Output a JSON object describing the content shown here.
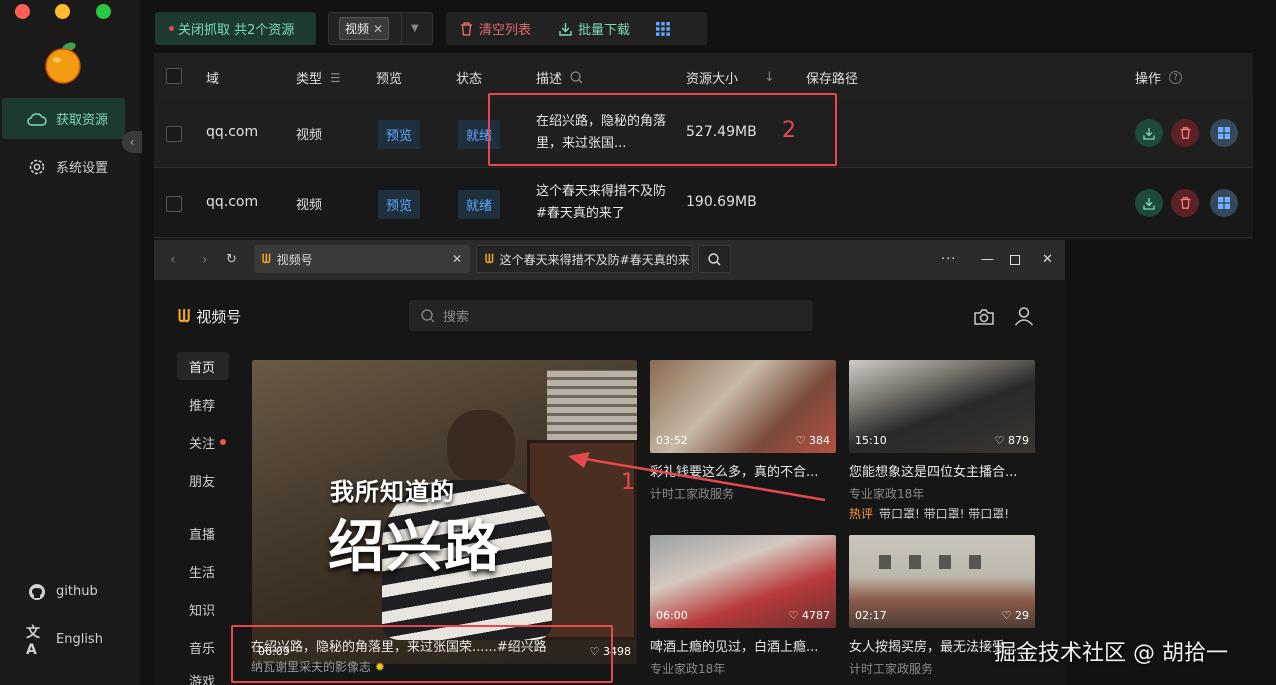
{
  "sidebar": {
    "items": [
      {
        "label": "获取资源",
        "icon": "cloud-icon"
      },
      {
        "label": "系统设置",
        "icon": "gear-icon"
      },
      {
        "label": "github",
        "icon": "github-icon"
      },
      {
        "label": "English",
        "icon": "translate-icon"
      }
    ]
  },
  "toolbar": {
    "capture_label": "关闭抓取 共2个资源",
    "filter_tag": "视频",
    "clear_label": "清空列表",
    "batch_download_label": "批量下载"
  },
  "table": {
    "headers": {
      "domain": "域",
      "type": "类型",
      "preview": "预览",
      "status": "状态",
      "desc": "描述",
      "size": "资源大小",
      "path": "保存路径",
      "ops": "操作"
    },
    "rows": [
      {
        "domain": "qq.com",
        "type": "视频",
        "preview": "预览",
        "status": "就绪",
        "desc": "在绍兴路，隐秘的角落里，来过张国...",
        "size": "527.49MB"
      },
      {
        "domain": "qq.com",
        "type": "视频",
        "preview": "预览",
        "status": "就绪",
        "desc": "这个春天来得措不及防#春天真的来了",
        "size": "190.69MB"
      }
    ]
  },
  "browser": {
    "tabs": [
      {
        "label": "视频号"
      },
      {
        "label": "这个春天来得措不及防#春天真的来"
      }
    ],
    "brand": "视频号",
    "search_placeholder": "搜索",
    "nav": [
      "首页",
      "推荐",
      "关注",
      "朋友",
      "直播",
      "生活",
      "知识",
      "音乐",
      "游戏"
    ],
    "featured": {
      "overlay_line1": "我所知道的",
      "overlay_line2": "绍兴路",
      "duration": "06:09",
      "likes": "3498",
      "title": "在绍兴路，隐秘的角落里，来过张国荣......#绍兴路",
      "author": "纳瓦谢里采夫的影像志"
    },
    "cards": [
      {
        "duration": "03:52",
        "likes": "384",
        "title": "彩礼钱要这么多，真的不合...",
        "author": "计时工家政服务",
        "hot_label": "",
        "hot_text": ""
      },
      {
        "duration": "15:10",
        "likes": "879",
        "title": "您能想象这是四位女主播合...",
        "author": "专业家政18年",
        "hot_label": "热评",
        "hot_text": "带口罩! 带口罩! 带口罩!"
      },
      {
        "duration": "06:00",
        "likes": "4787",
        "title": "啤酒上瘾的见过，白酒上瘾...",
        "author": "专业家政18年",
        "hot_label": "",
        "hot_text": ""
      },
      {
        "duration": "02:17",
        "likes": "29",
        "title": "女人按揭买房，最无法接受...",
        "author": "计时工家政服务",
        "hot_label": "",
        "hot_text": ""
      }
    ]
  },
  "annotations": {
    "label_1": "1",
    "label_2": "2"
  },
  "watermark": "掘金技术社区 @ 胡拾一",
  "colors": {
    "accent_green": "#7fd9b4",
    "danger_red": "#e5484d",
    "link_blue": "#5fa8ff"
  }
}
